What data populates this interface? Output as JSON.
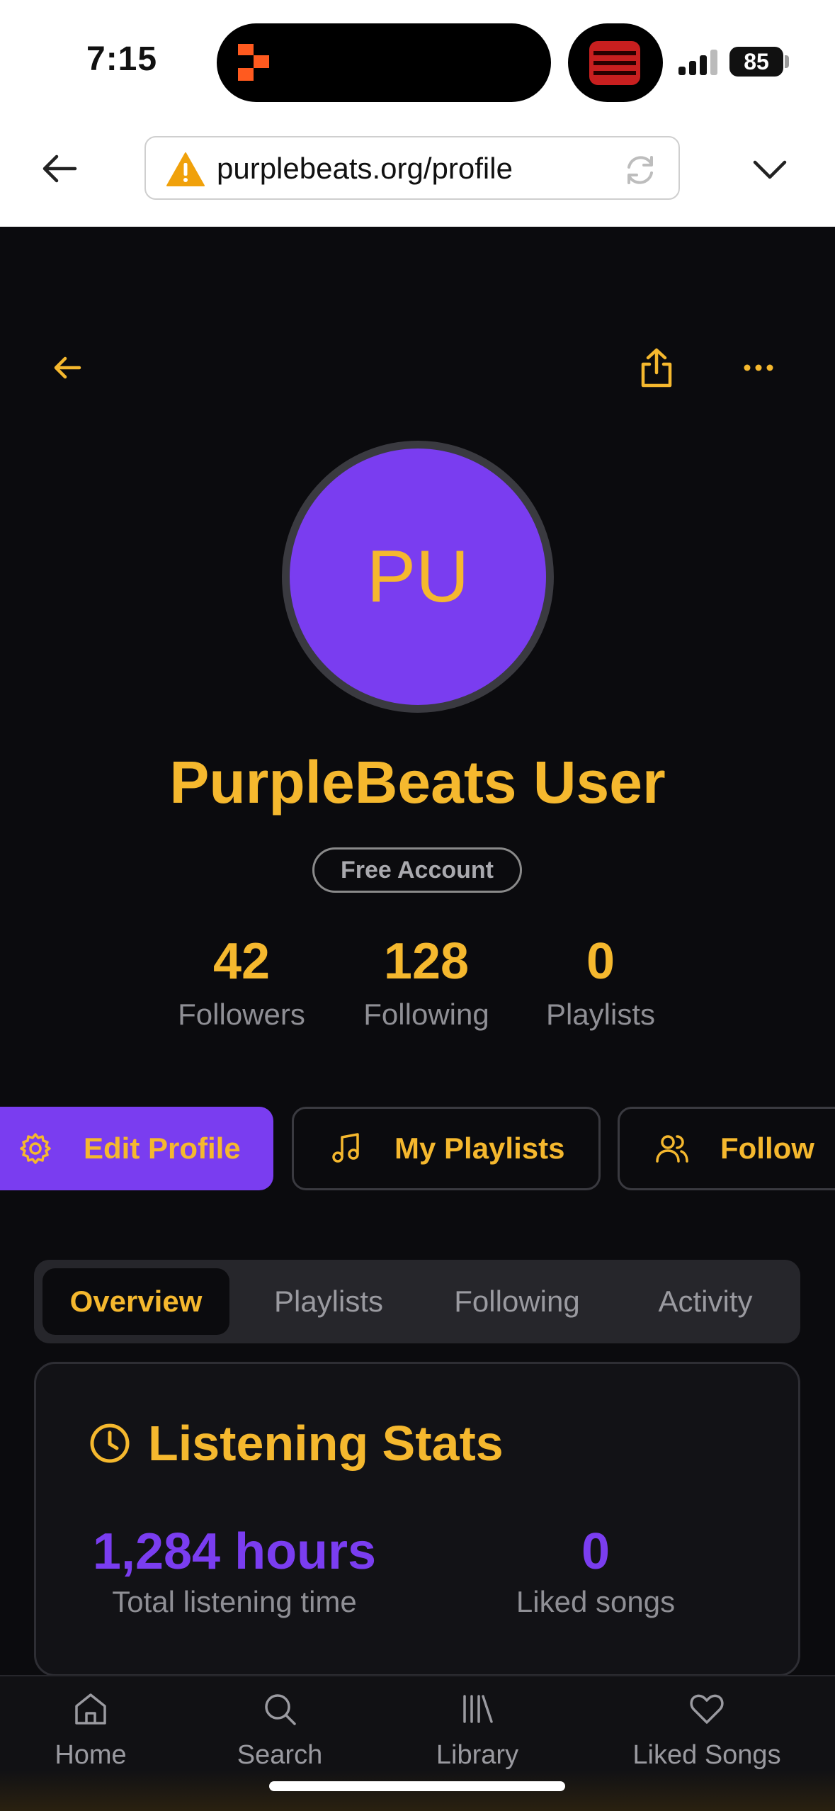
{
  "status_bar": {
    "time": "7:15",
    "battery": "85"
  },
  "browser": {
    "url": "purplebeats.org/profile"
  },
  "profile": {
    "avatar_initials": "PU",
    "name": "PurpleBeats User",
    "account_type": "Free Account",
    "stats": [
      {
        "value": "42",
        "label": "Followers"
      },
      {
        "value": "128",
        "label": "Following"
      },
      {
        "value": "0",
        "label": "Playlists"
      }
    ]
  },
  "actions": {
    "edit_profile": "Edit Profile",
    "my_playlists": "My Playlists",
    "follow": "Follow"
  },
  "tabs": [
    {
      "label": "Overview",
      "active": true
    },
    {
      "label": "Playlists",
      "active": false
    },
    {
      "label": "Following",
      "active": false
    },
    {
      "label": "Activity",
      "active": false
    }
  ],
  "listening_stats": {
    "title": "Listening Stats",
    "items": [
      {
        "value": "1,284 hours",
        "label": "Total listening time"
      },
      {
        "value": "0",
        "label": "Liked songs"
      }
    ]
  },
  "bottom_nav": [
    {
      "label": "Home",
      "icon": "home-icon"
    },
    {
      "label": "Search",
      "icon": "search-icon"
    },
    {
      "label": "Library",
      "icon": "library-icon"
    },
    {
      "label": "Liked Songs",
      "icon": "heart-icon"
    }
  ],
  "colors": {
    "accent": "#f5b82e",
    "brand_purple": "#7a3df0",
    "background": "#0b0b0e"
  }
}
